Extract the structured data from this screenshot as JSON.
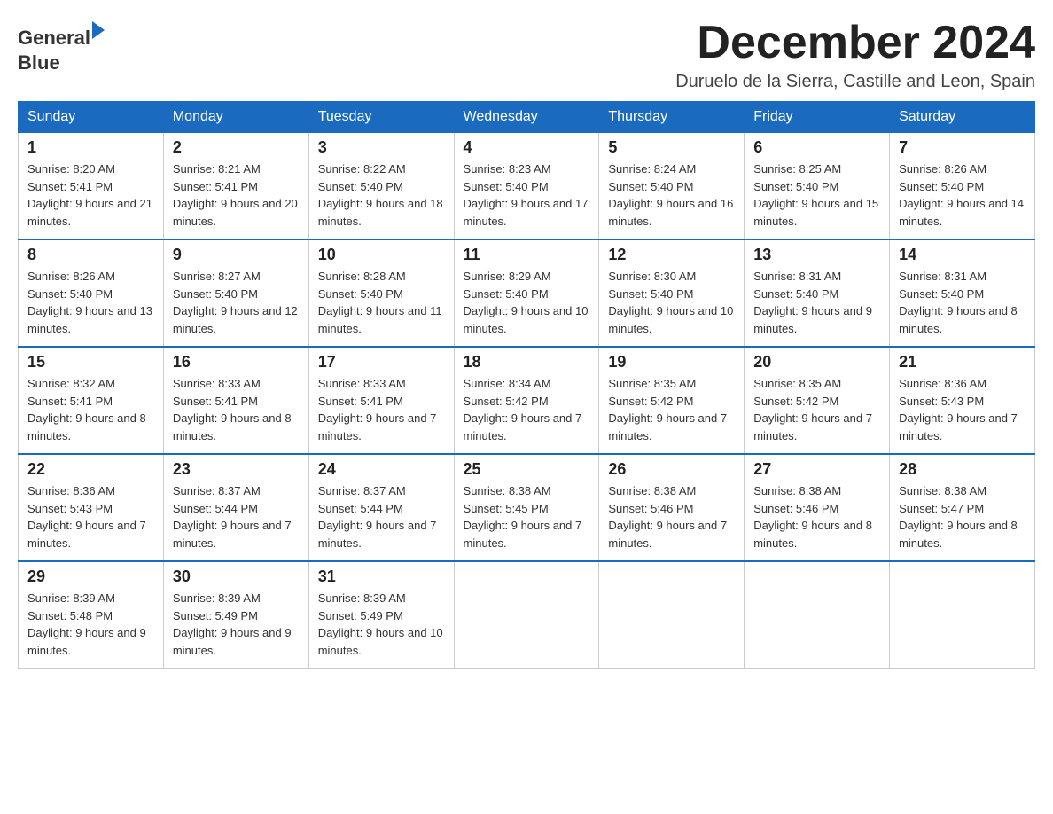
{
  "logo": {
    "line1": "General",
    "line2": "Blue"
  },
  "header": {
    "month_title": "December 2024",
    "location": "Duruelo de la Sierra, Castille and Leon, Spain"
  },
  "weekdays": [
    "Sunday",
    "Monday",
    "Tuesday",
    "Wednesday",
    "Thursday",
    "Friday",
    "Saturday"
  ],
  "weeks": [
    [
      {
        "day": "1",
        "sunrise": "8:20 AM",
        "sunset": "5:41 PM",
        "daylight": "9 hours and 21 minutes."
      },
      {
        "day": "2",
        "sunrise": "8:21 AM",
        "sunset": "5:41 PM",
        "daylight": "9 hours and 20 minutes."
      },
      {
        "day": "3",
        "sunrise": "8:22 AM",
        "sunset": "5:40 PM",
        "daylight": "9 hours and 18 minutes."
      },
      {
        "day": "4",
        "sunrise": "8:23 AM",
        "sunset": "5:40 PM",
        "daylight": "9 hours and 17 minutes."
      },
      {
        "day": "5",
        "sunrise": "8:24 AM",
        "sunset": "5:40 PM",
        "daylight": "9 hours and 16 minutes."
      },
      {
        "day": "6",
        "sunrise": "8:25 AM",
        "sunset": "5:40 PM",
        "daylight": "9 hours and 15 minutes."
      },
      {
        "day": "7",
        "sunrise": "8:26 AM",
        "sunset": "5:40 PM",
        "daylight": "9 hours and 14 minutes."
      }
    ],
    [
      {
        "day": "8",
        "sunrise": "8:26 AM",
        "sunset": "5:40 PM",
        "daylight": "9 hours and 13 minutes."
      },
      {
        "day": "9",
        "sunrise": "8:27 AM",
        "sunset": "5:40 PM",
        "daylight": "9 hours and 12 minutes."
      },
      {
        "day": "10",
        "sunrise": "8:28 AM",
        "sunset": "5:40 PM",
        "daylight": "9 hours and 11 minutes."
      },
      {
        "day": "11",
        "sunrise": "8:29 AM",
        "sunset": "5:40 PM",
        "daylight": "9 hours and 10 minutes."
      },
      {
        "day": "12",
        "sunrise": "8:30 AM",
        "sunset": "5:40 PM",
        "daylight": "9 hours and 10 minutes."
      },
      {
        "day": "13",
        "sunrise": "8:31 AM",
        "sunset": "5:40 PM",
        "daylight": "9 hours and 9 minutes."
      },
      {
        "day": "14",
        "sunrise": "8:31 AM",
        "sunset": "5:40 PM",
        "daylight": "9 hours and 8 minutes."
      }
    ],
    [
      {
        "day": "15",
        "sunrise": "8:32 AM",
        "sunset": "5:41 PM",
        "daylight": "9 hours and 8 minutes."
      },
      {
        "day": "16",
        "sunrise": "8:33 AM",
        "sunset": "5:41 PM",
        "daylight": "9 hours and 8 minutes."
      },
      {
        "day": "17",
        "sunrise": "8:33 AM",
        "sunset": "5:41 PM",
        "daylight": "9 hours and 7 minutes."
      },
      {
        "day": "18",
        "sunrise": "8:34 AM",
        "sunset": "5:42 PM",
        "daylight": "9 hours and 7 minutes."
      },
      {
        "day": "19",
        "sunrise": "8:35 AM",
        "sunset": "5:42 PM",
        "daylight": "9 hours and 7 minutes."
      },
      {
        "day": "20",
        "sunrise": "8:35 AM",
        "sunset": "5:42 PM",
        "daylight": "9 hours and 7 minutes."
      },
      {
        "day": "21",
        "sunrise": "8:36 AM",
        "sunset": "5:43 PM",
        "daylight": "9 hours and 7 minutes."
      }
    ],
    [
      {
        "day": "22",
        "sunrise": "8:36 AM",
        "sunset": "5:43 PM",
        "daylight": "9 hours and 7 minutes."
      },
      {
        "day": "23",
        "sunrise": "8:37 AM",
        "sunset": "5:44 PM",
        "daylight": "9 hours and 7 minutes."
      },
      {
        "day": "24",
        "sunrise": "8:37 AM",
        "sunset": "5:44 PM",
        "daylight": "9 hours and 7 minutes."
      },
      {
        "day": "25",
        "sunrise": "8:38 AM",
        "sunset": "5:45 PM",
        "daylight": "9 hours and 7 minutes."
      },
      {
        "day": "26",
        "sunrise": "8:38 AM",
        "sunset": "5:46 PM",
        "daylight": "9 hours and 7 minutes."
      },
      {
        "day": "27",
        "sunrise": "8:38 AM",
        "sunset": "5:46 PM",
        "daylight": "9 hours and 8 minutes."
      },
      {
        "day": "28",
        "sunrise": "8:38 AM",
        "sunset": "5:47 PM",
        "daylight": "9 hours and 8 minutes."
      }
    ],
    [
      {
        "day": "29",
        "sunrise": "8:39 AM",
        "sunset": "5:48 PM",
        "daylight": "9 hours and 9 minutes."
      },
      {
        "day": "30",
        "sunrise": "8:39 AM",
        "sunset": "5:49 PM",
        "daylight": "9 hours and 9 minutes."
      },
      {
        "day": "31",
        "sunrise": "8:39 AM",
        "sunset": "5:49 PM",
        "daylight": "9 hours and 10 minutes."
      },
      null,
      null,
      null,
      null
    ]
  ],
  "labels": {
    "sunrise": "Sunrise:",
    "sunset": "Sunset:",
    "daylight": "Daylight:"
  }
}
